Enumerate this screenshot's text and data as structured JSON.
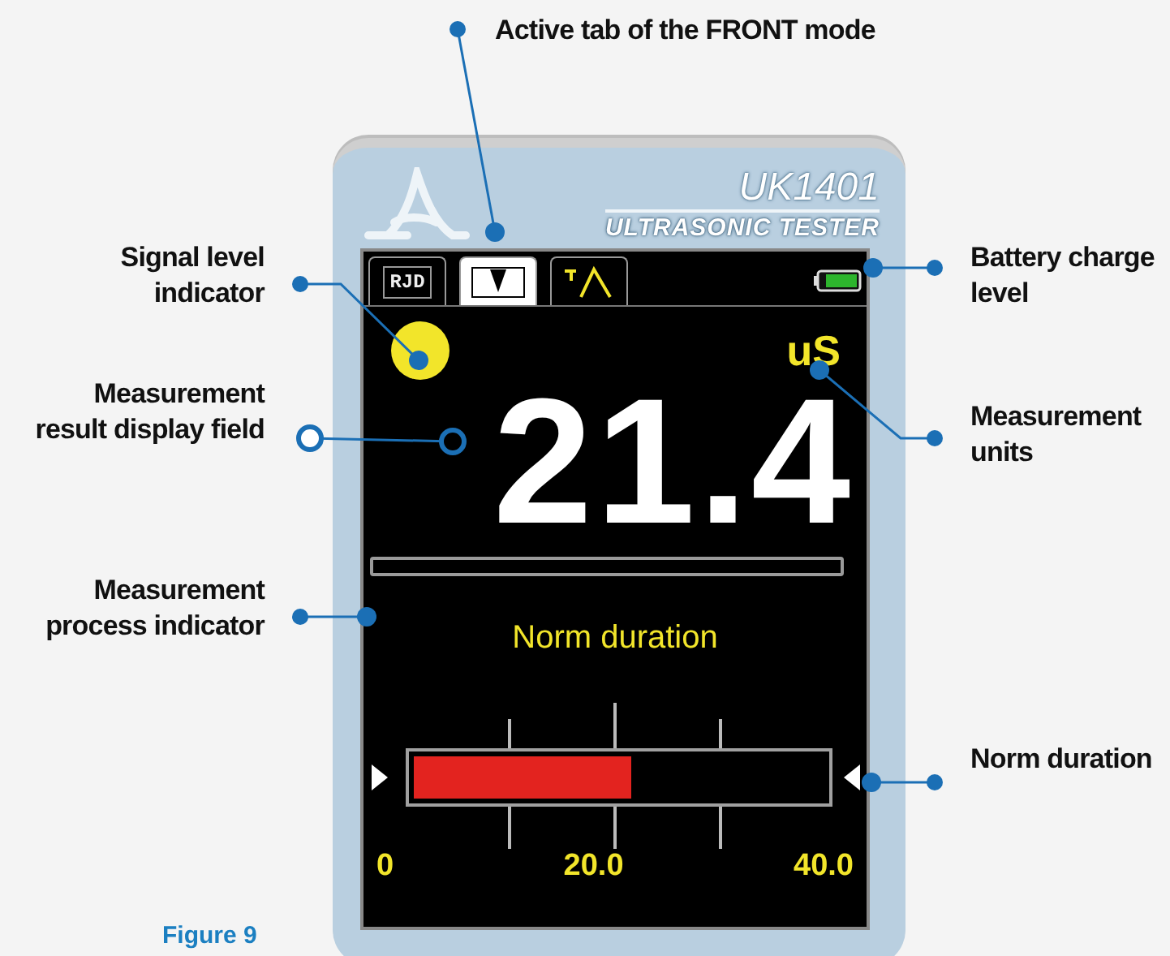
{
  "callouts": [
    {
      "text": "Active tab of the FRONT mode",
      "kind": "dot"
    },
    {
      "text": "Signal level indicator",
      "kind": "dot"
    },
    {
      "text": "Measurement result display field",
      "kind": "ring"
    },
    {
      "text": "Measurement process indicator",
      "kind": "dot"
    },
    {
      "text": "Battery charge level",
      "kind": "dot"
    },
    {
      "text": "Measurement units",
      "kind": "dot"
    },
    {
      "text": "Norm duration",
      "kind": "dot"
    }
  ],
  "device": {
    "model": "UK1401",
    "subtitle": "ULTRASONIC TESTER",
    "tabs": [
      {
        "kind": "text",
        "label": "RJD",
        "selected": false
      },
      {
        "kind": "front",
        "selected": true
      },
      {
        "kind": "wave",
        "selected": false
      }
    ],
    "units": "uS",
    "reading": "21.4",
    "process_bar": {
      "level": 0
    },
    "gauge_title": "Norm duration",
    "gauge": {
      "level": 0.53,
      "scale_labels": [
        "0",
        "20.0",
        "40.0"
      ]
    }
  },
  "figure_caption": "Figure 9"
}
